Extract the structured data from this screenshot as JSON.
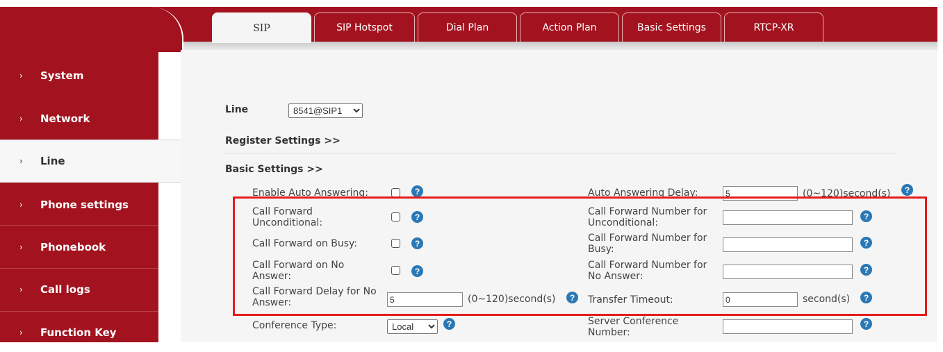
{
  "tabs": [
    {
      "label": "SIP",
      "active": true
    },
    {
      "label": "SIP Hotspot"
    },
    {
      "label": "Dial Plan"
    },
    {
      "label": "Action Plan"
    },
    {
      "label": "Basic Settings"
    },
    {
      "label": "RTCP-XR"
    }
  ],
  "sidebar": {
    "items": [
      {
        "label": "System"
      },
      {
        "label": "Network"
      },
      {
        "label": "Line",
        "active": true
      },
      {
        "label": "Phone settings"
      },
      {
        "label": "Phonebook"
      },
      {
        "label": "Call logs"
      },
      {
        "label": "Function Key"
      }
    ],
    "chevron": "›"
  },
  "line": {
    "label": "Line",
    "selected": "8541@SIP1"
  },
  "sections": {
    "register": "Register Settings >>",
    "basic": "Basic Settings >>"
  },
  "fields": {
    "auto_answer": {
      "label": "Enable Auto Answering:"
    },
    "auto_answer_delay": {
      "label": "Auto Answering Delay:",
      "value": "5",
      "unit": "(0~120)second(s)"
    },
    "cf_unconditional": {
      "label": "Call Forward\nUnconditional:"
    },
    "cf_number_unconditional": {
      "label": "Call Forward Number for\nUnconditional:",
      "value": ""
    },
    "cf_busy": {
      "label": "Call Forward on Busy:"
    },
    "cf_number_busy": {
      "label": "Call Forward Number for\nBusy:",
      "value": ""
    },
    "cf_no_answer": {
      "label": "Call Forward on No\nAnswer:"
    },
    "cf_number_no_answer": {
      "label": "Call Forward Number for\nNo Answer:",
      "value": ""
    },
    "cf_delay": {
      "label": "Call Forward Delay for No\nAnswer:",
      "value": "5",
      "unit": "(0~120)second(s)"
    },
    "transfer_timeout": {
      "label": "Transfer Timeout:",
      "value": "0",
      "unit": "second(s)"
    },
    "conference_type": {
      "label": "Conference Type:",
      "selected": "Local"
    },
    "server_conference_number": {
      "label": "Server Conference\nNumber:",
      "value": ""
    }
  },
  "help_glyph": "?",
  "icons": {
    "help": "question-circle-icon",
    "chevron": "chevron-right-icon",
    "dropdown": "chevron-down-icon"
  },
  "colors": {
    "brand_red": "#a3131f",
    "help_blue": "#2a78b5",
    "highlight_border": "#e41b1b"
  }
}
